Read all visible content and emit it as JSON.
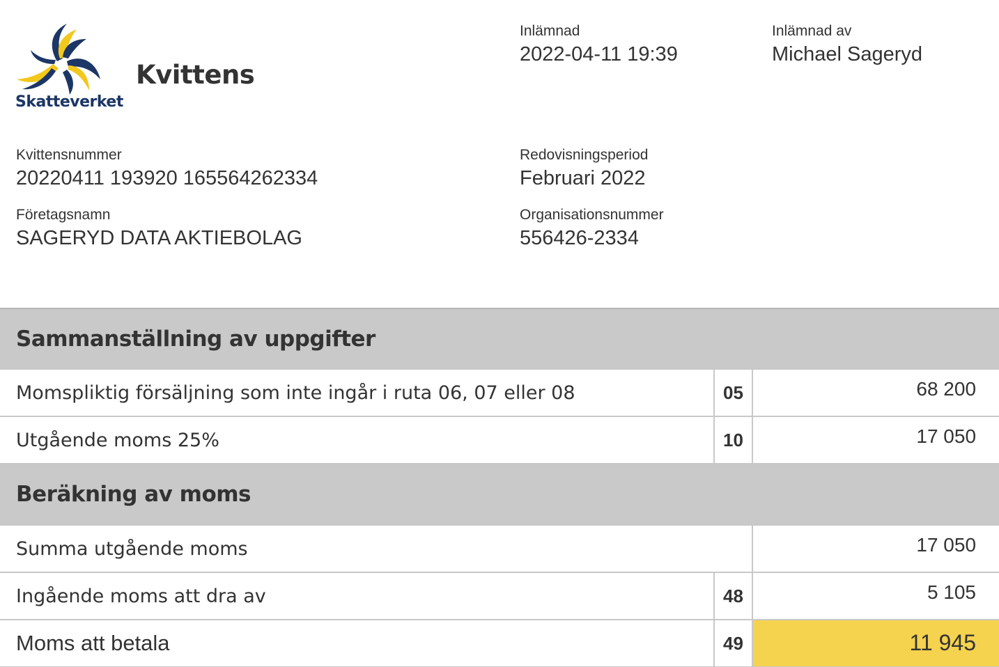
{
  "header": {
    "logo_text": "Skatteverket",
    "title": "Kvittens"
  },
  "meta": {
    "submitted_label": "Inlämnad",
    "submitted_value": "2022-04-11 19:39",
    "submitter_label": "Inlämnad av",
    "submitter_value": "Michael Sageryd",
    "receipt_label": "Kvittensnummer",
    "receipt_value": "20220411 193920 165564262334",
    "period_label": "Redovisningsperiod",
    "period_value": "Februari 2022",
    "company_label": "Företagsnamn",
    "company_value": "SAGERYD DATA AKTIEBOLAG",
    "orgnr_label": "Organisationsnummer",
    "orgnr_value": "556426-2334"
  },
  "sections": [
    {
      "title": "Sammanställning av uppgifter",
      "rows": [
        {
          "label": "Momspliktig försäljning som inte ingår i ruta 06, 07 eller 08",
          "box": "05",
          "amount": "68 200"
        },
        {
          "label": "Utgående moms 25%",
          "box": "10",
          "amount": "17 050"
        }
      ]
    },
    {
      "title": "Beräkning av moms",
      "rows": [
        {
          "label": "Summa utgående moms",
          "box": "",
          "amount": "17 050"
        },
        {
          "label": "Ingående moms att dra av",
          "box": "48",
          "amount": "5 105"
        },
        {
          "label": "Moms att betala",
          "box": "49",
          "amount": "11 945"
        }
      ]
    }
  ],
  "colors": {
    "logo_blue": "#1c3666",
    "logo_yellow": "#f2c81c",
    "section_bg": "#c9c9c9",
    "highlight": "#f5d34f"
  },
  "icons": {
    "logo": "skatteverket-swirl-logo"
  }
}
